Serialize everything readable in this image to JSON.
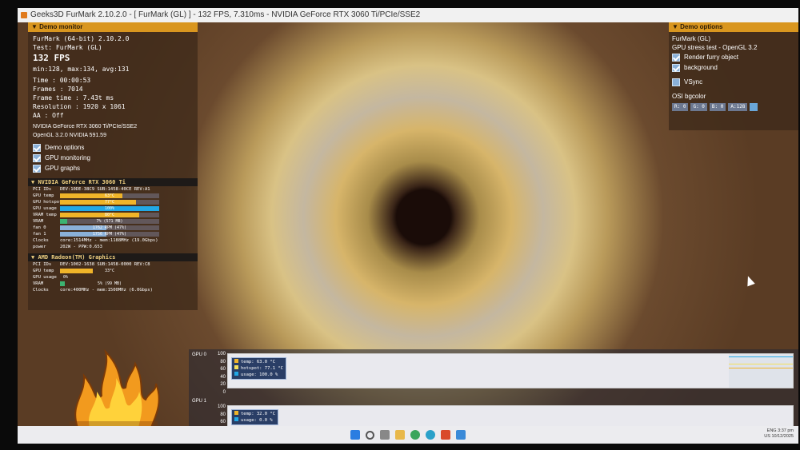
{
  "window": {
    "title": "Geeks3D FurMark 2.10.2.0 - [ FurMark (GL) ] - 132 FPS, 7.310ms - NVIDIA GeForce RTX 3060 Ti/PCIe/SSE2"
  },
  "monitor": {
    "header": "Demo monitor",
    "app_name": "FurMark (64-bit) 2.10.2.0",
    "test": "Test: FurMark (GL)",
    "fps": "132 FPS",
    "fps_stats": "min:128, max:134, avg:131",
    "time": "Time        : 00:00:53",
    "frames": "Frames      : 7014",
    "frame_time": "Frame time  : 7.43t ms",
    "resolution": "Resolution  : 1920 x 1061",
    "aa": "AA          : Off",
    "gpu_name": "NVIDIA GeForce RTX 3060 Ti/PCIe/SSE2",
    "opengl": "OpenGL 3.2.0 NVIDIA 591.59",
    "checkboxes": [
      {
        "label": "Demo options",
        "checked": true
      },
      {
        "label": "GPU monitoring",
        "checked": true
      },
      {
        "label": "GPU graphs",
        "checked": true
      }
    ]
  },
  "gpu0": {
    "title": "NVIDIA GeForce RTX 3060 Ti",
    "pci": "DEV:10DE-38C9 SUB:1458-40CE REV:A1",
    "temp": {
      "label": "GPU temp",
      "text": "63°C",
      "fraction": 0.63,
      "color": "#f0b429"
    },
    "hotspot": {
      "label": "GPU hotspot",
      "text": "77°C",
      "fraction": 0.77,
      "color": "#f0b429"
    },
    "usage": {
      "label": "GPU usage",
      "text": "100%",
      "fraction": 1.0,
      "color": "#22a8e6"
    },
    "vram_temp": {
      "label": "VRAM temp",
      "text": "80°C",
      "fraction": 0.8,
      "color": "#f0b429"
    },
    "vram": {
      "label": "VRAM",
      "text": "7% (571 MB)",
      "fraction": 0.07,
      "color": "#3cb371"
    },
    "fan0": {
      "label": "fan 0",
      "text": "1762 RPM (47%)",
      "fraction": 0.47,
      "color": "#8ab0d8"
    },
    "fan1": {
      "label": "fan 1",
      "text": "1756 RPM (47%)",
      "fraction": 0.47,
      "color": "#8ab0d8"
    },
    "clocks": {
      "label": "Clocks",
      "text": "core:1514MHz - mem:1188MHz (19.0Gbps)"
    },
    "power": {
      "label": "power",
      "text": "202W - PPW:0.653"
    }
  },
  "gpu1": {
    "title": "AMD Radeon(TM) Graphics",
    "pci": "DEV:1002-1638 SUB:1458-0000 REV:C8",
    "temp": {
      "label": "GPU temp",
      "text": "33°C",
      "fraction": 0.33,
      "color": "#f0b429"
    },
    "usage": {
      "label": "GPU usage",
      "text": "0%",
      "fraction": 0.0,
      "color": "#22a8e6"
    },
    "vram": {
      "label": "VRAM",
      "text": "5% (99 MB)",
      "fraction": 0.05,
      "color": "#3cb371"
    },
    "clocks": {
      "label": "Clocks",
      "text": "core:400MHz - mem:1500MHz (6.0Gbps)"
    }
  },
  "options": {
    "header": "Demo options",
    "name": "FurMark (GL)",
    "subtitle": "GPU stress test - OpenGL 3.2",
    "checkboxes": [
      {
        "label": "Render furry object",
        "checked": true
      },
      {
        "label": "background",
        "checked": true
      },
      {
        "label": "VSync",
        "checked": false
      }
    ],
    "bgcolor_label": "OSI bgcolor",
    "bgcolor": [
      "R: 0",
      "G: 0",
      "B: 0",
      "A:128"
    ]
  },
  "graph": {
    "gpu0_label": "GPU 0",
    "gpu1_label": "GPU 1",
    "axis": [
      "100",
      "80",
      "60",
      "40",
      "20",
      "0"
    ],
    "axis1": [
      "100",
      "80",
      "60",
      "40"
    ],
    "gpu0_legend": [
      "temp: 63.0 °C",
      "hotspot: 77.1 °C",
      "usage: 100.0 %"
    ],
    "gpu1_legend": [
      "temp: 32.0 °C",
      "usage: 0.0 %"
    ]
  },
  "tray": {
    "lang": "ENG",
    "region": "US",
    "time": "3:37 pm",
    "date": "10/12/2025"
  }
}
